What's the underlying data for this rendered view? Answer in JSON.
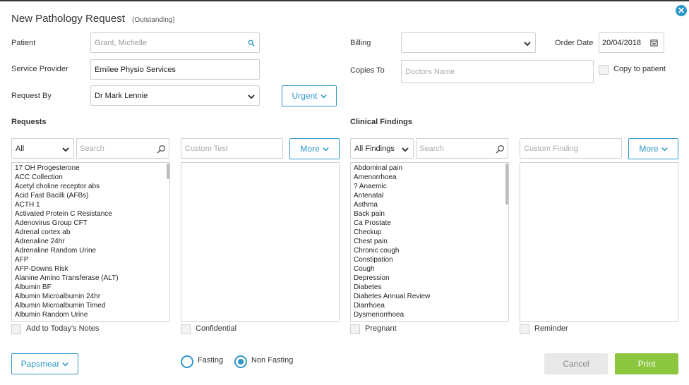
{
  "dialog": {
    "title": "New Pathology Request",
    "subtitle": "(Outstanding)",
    "close_glyph": "✕"
  },
  "form": {
    "patient_label": "Patient",
    "patient_value": "Grant, Michelle",
    "service_provider_label": "Service Provider",
    "service_provider_value": "Emilee Physio Services",
    "request_by_label": "Request By",
    "request_by_value": "Dr Mark Lennie",
    "urgent_label": "Urgent",
    "billing_label": "Billing",
    "billing_value": "",
    "order_date_label": "Order Date",
    "order_date_value": "20/04/2018",
    "copies_to_label": "Copies To",
    "copies_to_placeholder": "Doctors Name",
    "copy_to_patient_label": "Copy to patient"
  },
  "requests": {
    "section_title": "Requests",
    "filter_value": "All",
    "search_placeholder": "Search",
    "custom_placeholder": "Custom Test",
    "more_label": "More",
    "items": [
      "17 OH Progesterone",
      "ACC Collection",
      "Acetyl choline receptor abs",
      "Acid Fast Bacilli (AFBs)",
      "ACTH 1",
      "Activated Protein C Resistance",
      "Adenovirus Group CFT",
      "Adrenal cortex ab",
      "Adrenaline 24hr",
      "Adrenaline Random Urine",
      "AFP",
      "AFP-Downs Risk",
      "Alanine Amino Transferase (ALT)",
      "Albumin BF",
      "Albumin Microalbumin 24hr",
      "Albumin Microalbumin Timed",
      "Albumin Random Urine"
    ],
    "notes_label": "Add to Today's Notes",
    "confidential_label": "Confidential"
  },
  "findings": {
    "section_title": "Clinical Findings",
    "filter_value": "All Findings",
    "search_placeholder": "Search",
    "custom_placeholder": "Custom Finding",
    "more_label": "More",
    "items": [
      "Abdominal pain",
      "Amenorrhoea",
      "? Anaemic",
      "Antenatal",
      "Asthma",
      "Back pain",
      "Ca Prostate",
      "Checkup",
      "Chest pain",
      "Chronic cough",
      "Constipation",
      "Cough",
      "Depression",
      "Diabetes",
      "Diabetes Annual Review",
      "Diarrhoea",
      "Dysmenorrhoea"
    ],
    "pregnant_label": "Pregnant",
    "reminder_label": "Reminder"
  },
  "footer": {
    "papsmear_label": "Papsmear",
    "fasting_label": "Fasting",
    "non_fasting_label": "Non Fasting",
    "fasting_selected": "Non Fasting",
    "cancel_label": "Cancel",
    "print_label": "Print"
  },
  "colors": {
    "accent": "#2e97c8",
    "print": "#8cc63f",
    "cancel_bg": "#e8e8e8"
  }
}
